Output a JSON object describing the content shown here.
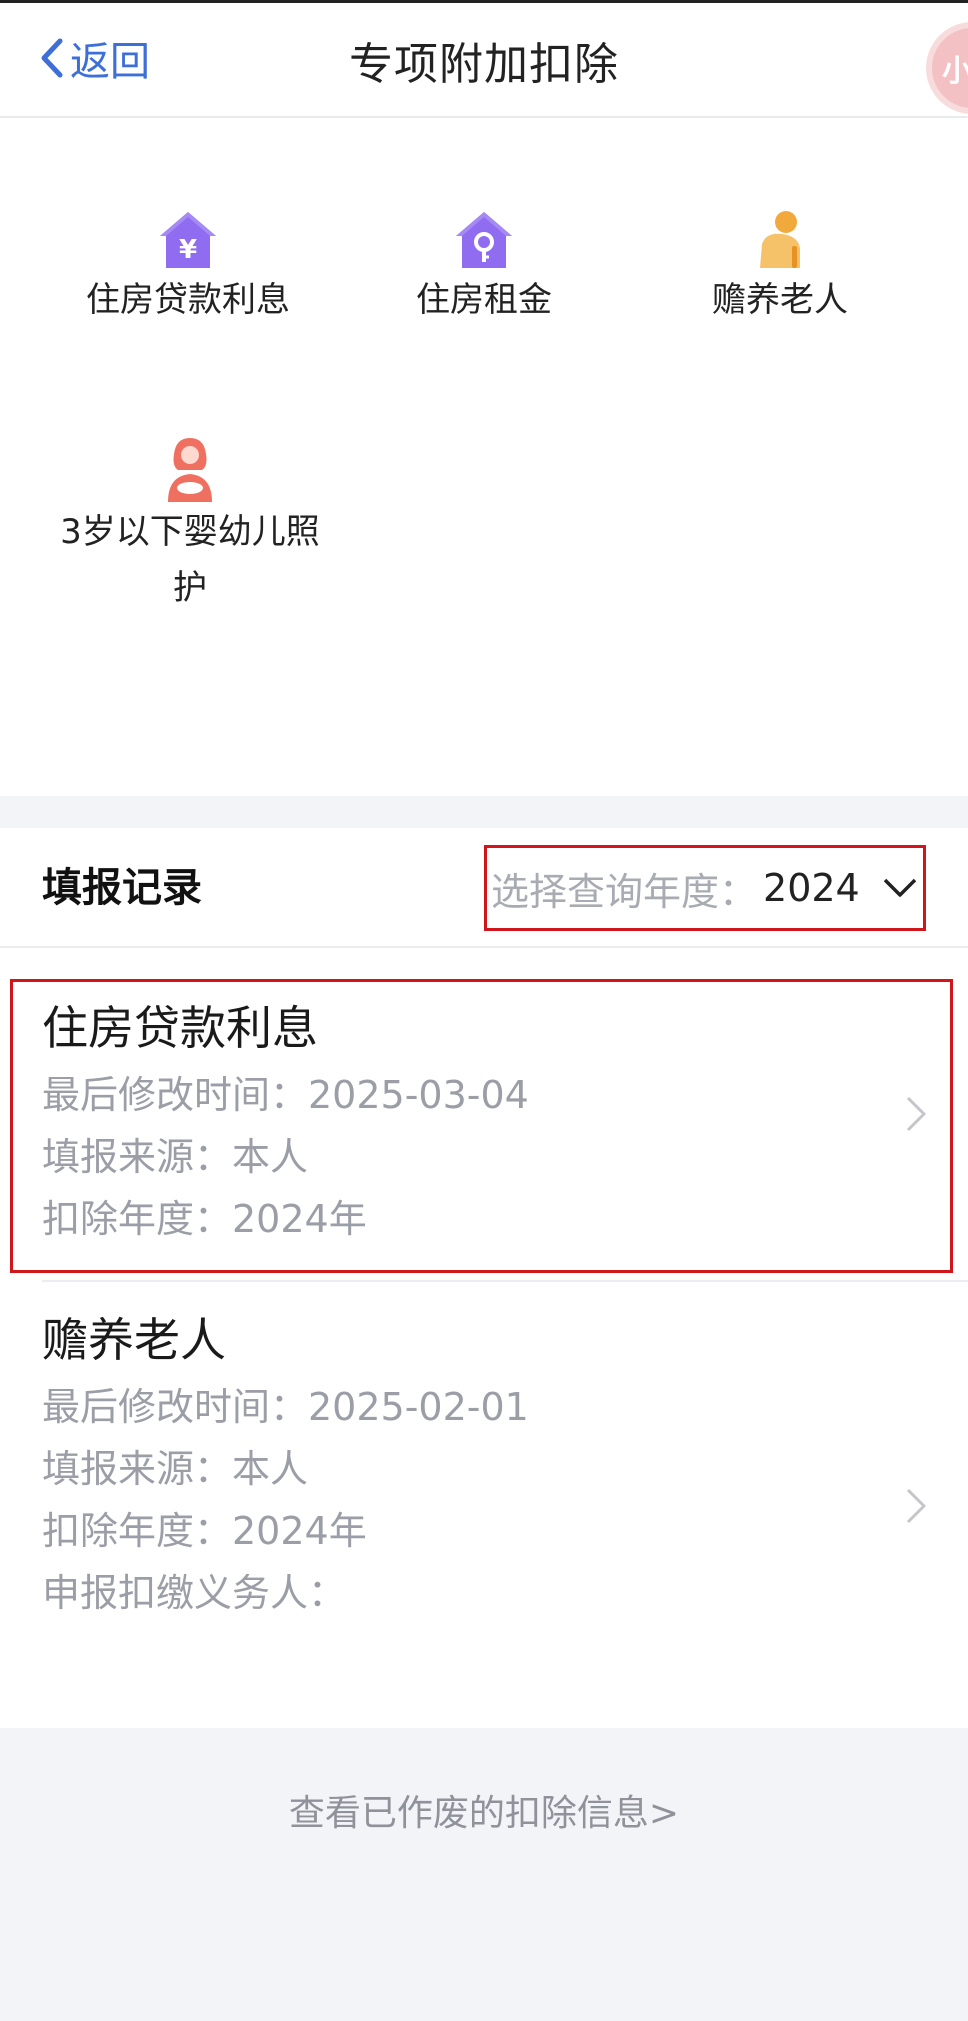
{
  "header": {
    "back_label": "返回",
    "title": "专项附加扣除",
    "float_badge": "小"
  },
  "categories": [
    {
      "label": "住房贷款利息",
      "icon": "house-yuan-icon",
      "color": "#8f6cf0"
    },
    {
      "label": "住房租金",
      "icon": "house-key-icon",
      "color": "#8f6cf0"
    },
    {
      "label": "赡养老人",
      "icon": "elderly-person-icon",
      "color": "#f2a93b"
    },
    {
      "label": "3岁以下婴幼儿照护",
      "label_line1": "3岁以下婴幼儿照",
      "label_line2": "护",
      "icon": "mother-baby-icon",
      "color": "#ef7060"
    }
  ],
  "records_section": {
    "title": "填报记录",
    "year_label": "选择查询年度：",
    "year_value": "2024"
  },
  "records": [
    {
      "title": "住房贷款利息",
      "last_modified": "最后修改时间：2025-03-04",
      "source": "填报来源：本人",
      "deduction_year": "扣除年度：2024年"
    },
    {
      "title": "赡养老人",
      "last_modified": "最后修改时间：2025-02-01",
      "source": "填报来源：本人",
      "deduction_year": "扣除年度：2024年",
      "withholder": "申报扣缴义务人："
    }
  ],
  "footer": {
    "link": "查看已作废的扣除信息>"
  },
  "colors": {
    "accent": "#3e6fd8",
    "highlight": "#d0161c",
    "muted_text": "#9b9ea6"
  }
}
